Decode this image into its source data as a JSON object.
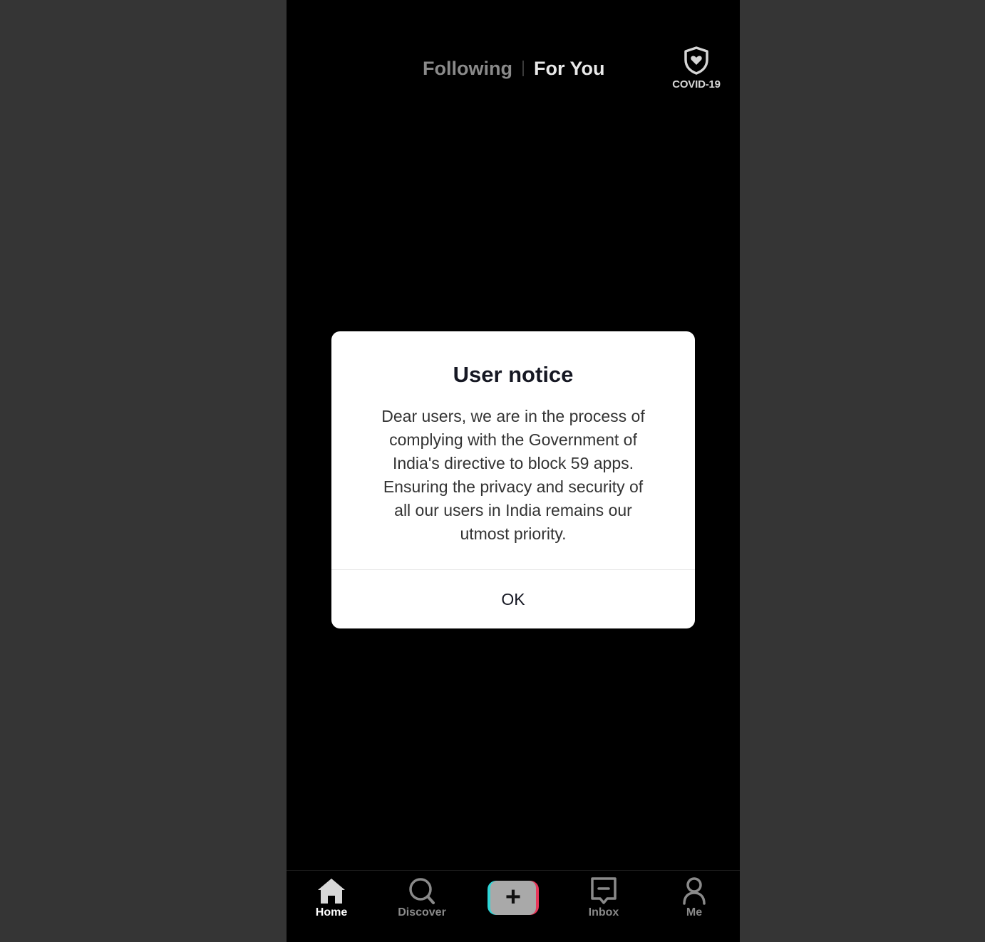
{
  "header": {
    "tabs": [
      {
        "label": "Following",
        "active": false
      },
      {
        "label": "For You",
        "active": true
      }
    ],
    "covid": {
      "label": "COVID-19",
      "icon": "shield-heart-icon"
    }
  },
  "dialog": {
    "title": "User notice",
    "body_lines": [
      "Dear users, we are in the process of",
      "complying with the Government of",
      "India's directive to block 59 apps.",
      "Ensuring the privacy and security of",
      "all our users in India remains our",
      "utmost priority."
    ],
    "ok_label": "OK"
  },
  "bottom_nav": {
    "items": [
      {
        "label": "Home",
        "icon": "home-icon",
        "active": true
      },
      {
        "label": "Discover",
        "icon": "search-icon",
        "active": false
      },
      {
        "label": "",
        "icon": "plus-icon",
        "active": false
      },
      {
        "label": "Inbox",
        "icon": "inbox-icon",
        "active": false
      },
      {
        "label": "Me",
        "icon": "profile-icon",
        "active": false
      }
    ]
  },
  "colors": {
    "background": "#353535",
    "screen": "#000000",
    "dialog": "#ffffff",
    "create_cyan": "#2fd6d8",
    "create_red": "#e8375a"
  }
}
